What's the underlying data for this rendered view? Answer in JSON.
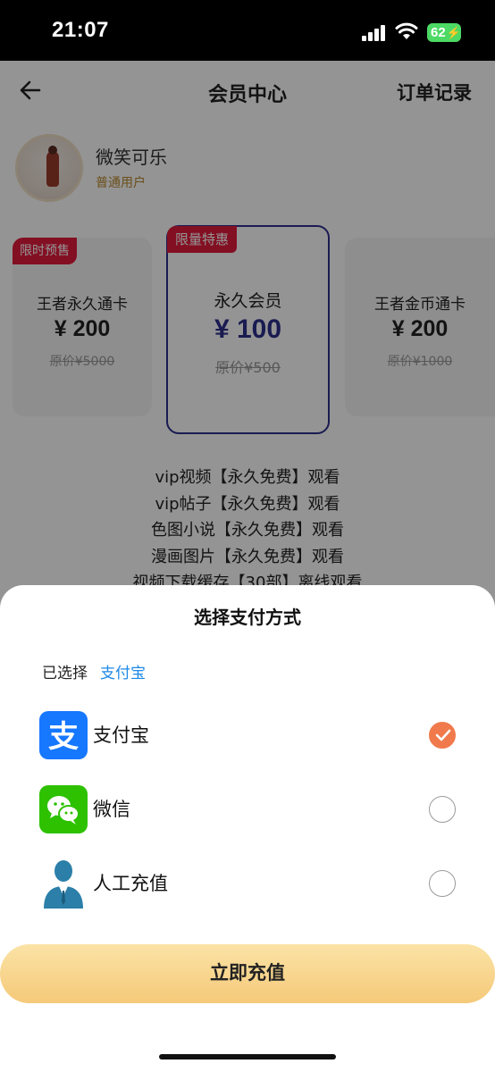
{
  "status_bar": {
    "time": "21:07",
    "battery": "62"
  },
  "header": {
    "title": "会员中心",
    "orders": "订单记录"
  },
  "user": {
    "name": "微笑可乐",
    "level": "普通用户"
  },
  "plans": [
    {
      "tag": "限时预售",
      "name": "王者永久通卡",
      "price": "¥ 200",
      "original": "原价¥5000"
    },
    {
      "tag": "限量特惠",
      "name": "永久会员",
      "price": "¥ 100",
      "original": "原价¥500"
    },
    {
      "tag": "",
      "name": "王者金币通卡",
      "price": "¥ 200",
      "original": "原价¥1000"
    }
  ],
  "benefits": [
    "vip视频【永久免费】观看",
    "vip帖子【永久免费】观看",
    "色图小说【永久免费】观看",
    "漫画图片【永久免费】观看",
    "视频下载缓存【30部】离线观看"
  ],
  "payment_sheet": {
    "title": "选择支付方式",
    "selected_label": "已选择",
    "selected_value": "支付宝",
    "methods": [
      {
        "label": "支付宝",
        "icon": "alipay-icon",
        "checked": true
      },
      {
        "label": "微信",
        "icon": "wechat-icon",
        "checked": false
      },
      {
        "label": "人工充值",
        "icon": "customer-service-icon",
        "checked": false
      }
    ],
    "button": "立即充值"
  },
  "colors": {
    "accent_check": "#f07a4c",
    "selected_text": "#1e88e5",
    "tag_red": "#e21b3c",
    "card_border": "#2f2f8f"
  }
}
